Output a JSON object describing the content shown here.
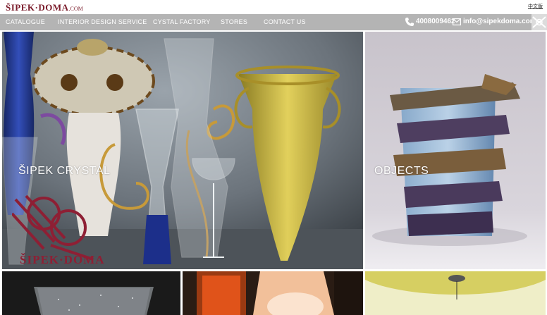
{
  "header": {
    "logo": {
      "main": "ŠIPEK·DOMA",
      "suffix": ".COM"
    },
    "language_link": "中文版"
  },
  "nav": {
    "items": [
      {
        "label": "CATALOGUE"
      },
      {
        "label": "INTERIOR DESIGN SERVICE"
      },
      {
        "label": "CYSTAL FACTORY"
      },
      {
        "label": "STORES"
      },
      {
        "label": "CONTACT US"
      }
    ],
    "phone": "4008009462",
    "email": "info@sipekdoma.com"
  },
  "tiles": {
    "crystal": {
      "label": "ŠIPEK CRYSTAL",
      "brand_text": "ŠIPEK·DOMA"
    },
    "objects": {
      "label": "OBJECTS"
    }
  },
  "colors": {
    "brand": "#7b1c2b",
    "nav_bg": "#b4b4b4",
    "nav_text": "#ffffff"
  },
  "icons": [
    "phone-icon",
    "mail-icon",
    "pattern-icon"
  ]
}
